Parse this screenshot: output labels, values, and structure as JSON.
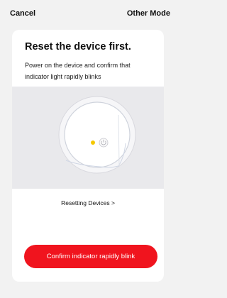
{
  "nav": {
    "cancel_label": "Cancel",
    "other_mode_label": "Other Mode"
  },
  "card": {
    "title": "Reset the device first.",
    "description": "Power on the device and confirm that indicator light rapidly blinks",
    "illustration": {
      "indicator_color": "#f5c800",
      "power_icon": "power-icon"
    },
    "help_link": "Resetting Devices >",
    "confirm_button_label": "Confirm indicator rapidly blink"
  },
  "colors": {
    "accent": "#f0141e",
    "background": "#f2f2f2",
    "card": "#ffffff"
  }
}
